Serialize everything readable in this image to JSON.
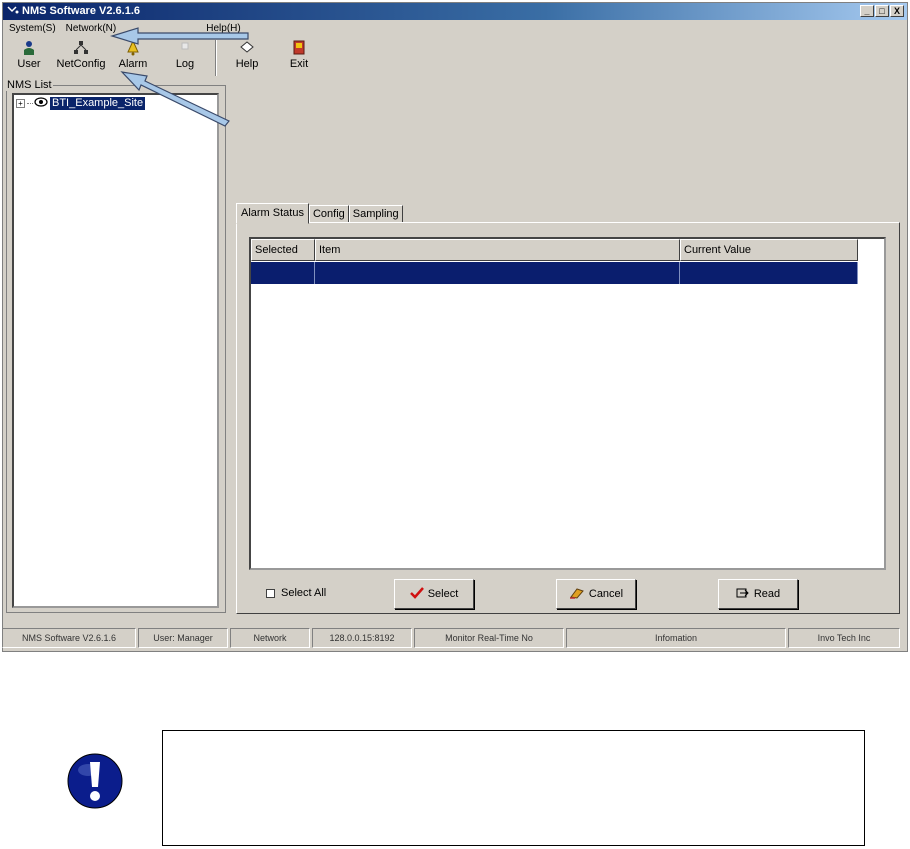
{
  "window": {
    "title": "NMS Software V2.6.1.6",
    "controls": [
      "_",
      "□",
      "X"
    ]
  },
  "menu": {
    "items": [
      "System(S)",
      "Network(N)",
      "...",
      "Window(W)",
      "Help(H)"
    ]
  },
  "toolbar": {
    "buttons": [
      {
        "label": "User",
        "icon": "user-icon"
      },
      {
        "label": "NetConfig",
        "icon": "netconfig-icon"
      },
      {
        "label": "Alarm",
        "icon": "alarm-icon"
      },
      {
        "label": "Log",
        "icon": "log-icon"
      },
      {
        "label": "Help",
        "icon": "help-icon"
      },
      {
        "label": "Exit",
        "icon": "exit-icon"
      }
    ]
  },
  "nms_list": {
    "legend": "NMS List",
    "site": "BTI_Example_Site"
  },
  "tabs": [
    "Alarm Status",
    "Config",
    "Sampling"
  ],
  "grid": {
    "columns": [
      "Selected",
      "Item",
      "Current Value"
    ]
  },
  "actions": {
    "select_all": "Select All",
    "select": "Select",
    "cancel": "Cancel",
    "read": "Read"
  },
  "status": {
    "cells": [
      "NMS Software V2.6.1.6",
      "User: Manager",
      "Network",
      "128.0.0.15:8192",
      "Monitor Real-Time No",
      "Infomation",
      "Invo Tech Inc"
    ]
  },
  "colors": {
    "selection": "#0a1e6e",
    "arrow": "#a8c8e8",
    "note_icon": "#0b1d8c"
  }
}
